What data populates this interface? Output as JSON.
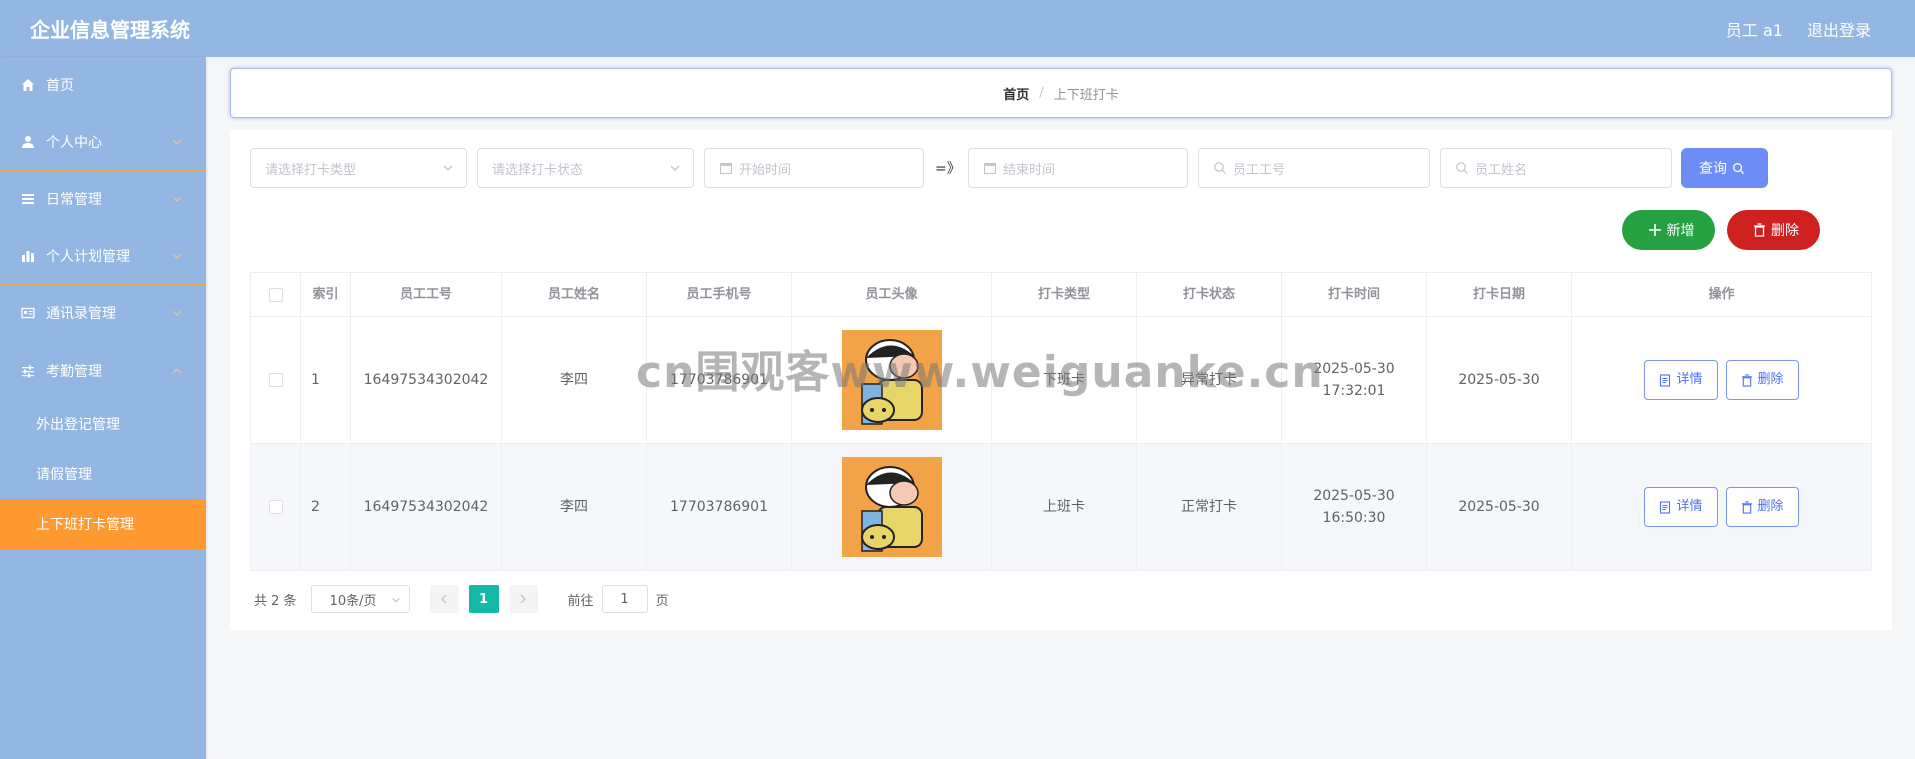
{
  "header": {
    "title": "企业信息管理系统",
    "user_label": "员工 a1",
    "logout_label": "退出登录"
  },
  "sidebar": {
    "items": [
      {
        "label": "首页",
        "icon": "home-icon"
      },
      {
        "label": "个人中心",
        "icon": "user-icon"
      },
      {
        "label": "日常管理",
        "icon": "list-icon"
      },
      {
        "label": "个人计划管理",
        "icon": "chart-icon"
      },
      {
        "label": "通讯录管理",
        "icon": "card-icon"
      },
      {
        "label": "考勤管理",
        "icon": "sliders-icon"
      }
    ],
    "sub_items": [
      {
        "label": "外出登记管理"
      },
      {
        "label": "请假管理"
      },
      {
        "label": "上下班打卡管理"
      }
    ]
  },
  "breadcrumb": {
    "home": "首页",
    "separator": "/",
    "current": "上下班打卡"
  },
  "filters": {
    "type_placeholder": "请选择打卡类型",
    "status_placeholder": "请选择打卡状态",
    "start_placeholder": "开始时间",
    "range_sep": "=》",
    "end_placeholder": "结束时间",
    "emp_no_placeholder": "员工工号",
    "emp_name_placeholder": "员工姓名",
    "query_label": "查询"
  },
  "actions": {
    "add_label": "新增",
    "delete_label": "删除"
  },
  "table": {
    "columns": [
      "索引",
      "员工工号",
      "员工姓名",
      "员工手机号",
      "员工头像",
      "打卡类型",
      "打卡状态",
      "打卡时间",
      "打卡日期",
      "操作"
    ],
    "rows": [
      {
        "index": "1",
        "emp_no": "16497534302042",
        "name": "李四",
        "phone": "17703786901",
        "type": "下班卡",
        "status": "异常打卡",
        "time": "2025-05-30 17:32:01",
        "date": "2025-05-30"
      },
      {
        "index": "2",
        "emp_no": "16497534302042",
        "name": "李四",
        "phone": "17703786901",
        "type": "上班卡",
        "status": "正常打卡",
        "time": "2025-05-30 16:50:30",
        "date": "2025-05-30"
      }
    ],
    "detail_label": "详情",
    "row_delete_label": "删除"
  },
  "pagination": {
    "total": "共 2 条",
    "page_size": "10条/页",
    "current_page": "1",
    "goto_prefix": "前往",
    "goto_value": "1",
    "goto_suffix": "页"
  },
  "watermark": "cn围观客www.weiguanke.cn",
  "colors": {
    "header": "#94b6e2",
    "active_menu": "#ff9a32",
    "primary": "#6d8cf5",
    "success": "#26a142",
    "danger": "#cf2020",
    "page_active": "#14b8a6"
  }
}
